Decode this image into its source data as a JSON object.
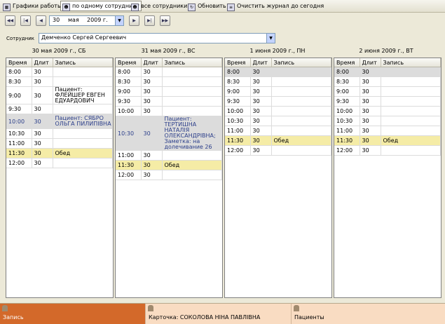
{
  "toolbar": {
    "schedule": "Графики работы",
    "single_employee": "по одному сотруднику",
    "all_employees": "все сотрудники",
    "refresh": "Обновить",
    "clear_log": "Очистить журнал до сегодня"
  },
  "date_picker": {
    "day": "30",
    "month": "мая",
    "year": "2009 г."
  },
  "employee": {
    "label": "Сотрудник",
    "value": "Демченко Сергей Сергеевич"
  },
  "columns": {
    "time": "Время",
    "duration": "Длит",
    "record": "Запись"
  },
  "days": [
    {
      "title": "30 мая 2009 г., СБ",
      "rows": [
        {
          "time": "8:00",
          "dur": "30",
          "rec": "",
          "style": ""
        },
        {
          "time": "8:30",
          "dur": "30",
          "rec": "",
          "style": ""
        },
        {
          "time": "9:00",
          "dur": "30",
          "rec": "Пациент: ФЛЕЙШЕР ЕВГЕН ЕДУАРДОВИЧ",
          "style": ""
        },
        {
          "time": "9:30",
          "dur": "30",
          "rec": "",
          "style": ""
        },
        {
          "time": "10:00",
          "dur": "30",
          "rec": "Пациент: СЯБРО ОЛЬГА ПИЛИПІВНА",
          "style": "booked"
        },
        {
          "time": "10:30",
          "dur": "30",
          "rec": "",
          "style": ""
        },
        {
          "time": "11:00",
          "dur": "30",
          "rec": "",
          "style": ""
        },
        {
          "time": "11:30",
          "dur": "30",
          "rec": "Обед",
          "style": "lunch"
        },
        {
          "time": "12:00",
          "dur": "30",
          "rec": "",
          "style": ""
        }
      ]
    },
    {
      "title": "31 мая 2009 г., ВС",
      "rows": [
        {
          "time": "8:00",
          "dur": "30",
          "rec": "",
          "style": ""
        },
        {
          "time": "8:30",
          "dur": "30",
          "rec": "",
          "style": ""
        },
        {
          "time": "9:00",
          "dur": "30",
          "rec": "",
          "style": ""
        },
        {
          "time": "9:30",
          "dur": "30",
          "rec": "",
          "style": ""
        },
        {
          "time": "10:00",
          "dur": "30",
          "rec": "",
          "style": ""
        },
        {
          "time": "10:30",
          "dur": "30",
          "rec": "Пациент: ТЕРТИШНА НАТАЛІЯ ОЛЕКСАНДРІВНА; Заметка: на долечивание 26",
          "style": "booked"
        },
        {
          "time": "11:00",
          "dur": "30",
          "rec": "",
          "style": ""
        },
        {
          "time": "11:30",
          "dur": "30",
          "rec": "Обед",
          "style": "lunch"
        },
        {
          "time": "12:00",
          "dur": "30",
          "rec": "",
          "style": ""
        }
      ]
    },
    {
      "title": "1 июня 2009 г., ПН",
      "rows": [
        {
          "time": "8:00",
          "dur": "30",
          "rec": "",
          "style": "sel"
        },
        {
          "time": "8:30",
          "dur": "30",
          "rec": "",
          "style": ""
        },
        {
          "time": "9:00",
          "dur": "30",
          "rec": "",
          "style": ""
        },
        {
          "time": "9:30",
          "dur": "30",
          "rec": "",
          "style": ""
        },
        {
          "time": "10:00",
          "dur": "30",
          "rec": "",
          "style": ""
        },
        {
          "time": "10:30",
          "dur": "30",
          "rec": "",
          "style": ""
        },
        {
          "time": "11:00",
          "dur": "30",
          "rec": "",
          "style": ""
        },
        {
          "time": "11:30",
          "dur": "30",
          "rec": "Обед",
          "style": "lunch"
        },
        {
          "time": "12:00",
          "dur": "30",
          "rec": "",
          "style": ""
        }
      ]
    },
    {
      "title": "2 июня 2009 г., ВТ",
      "rows": [
        {
          "time": "8:00",
          "dur": "30",
          "rec": "",
          "style": "sel"
        },
        {
          "time": "8:30",
          "dur": "30",
          "rec": "",
          "style": ""
        },
        {
          "time": "9:00",
          "dur": "30",
          "rec": "",
          "style": ""
        },
        {
          "time": "9:30",
          "dur": "30",
          "rec": "",
          "style": ""
        },
        {
          "time": "10:00",
          "dur": "30",
          "rec": "",
          "style": ""
        },
        {
          "time": "10:30",
          "dur": "30",
          "rec": "",
          "style": ""
        },
        {
          "time": "11:00",
          "dur": "30",
          "rec": "",
          "style": ""
        },
        {
          "time": "11:30",
          "dur": "30",
          "rec": "Обед",
          "style": "lunch"
        },
        {
          "time": "12:00",
          "dur": "30",
          "rec": "",
          "style": ""
        }
      ]
    }
  ],
  "bottom_tabs": {
    "record": "Запись",
    "card": "Карточка: СОКОЛОВА НІНА ПАВЛІВНА",
    "patients": "Пациенты"
  },
  "icons": {
    "nav": [
      "first-week-icon",
      "first-day-icon",
      "prev-day-icon",
      "next-day-icon",
      "last-day-icon",
      "last-week-icon"
    ]
  }
}
